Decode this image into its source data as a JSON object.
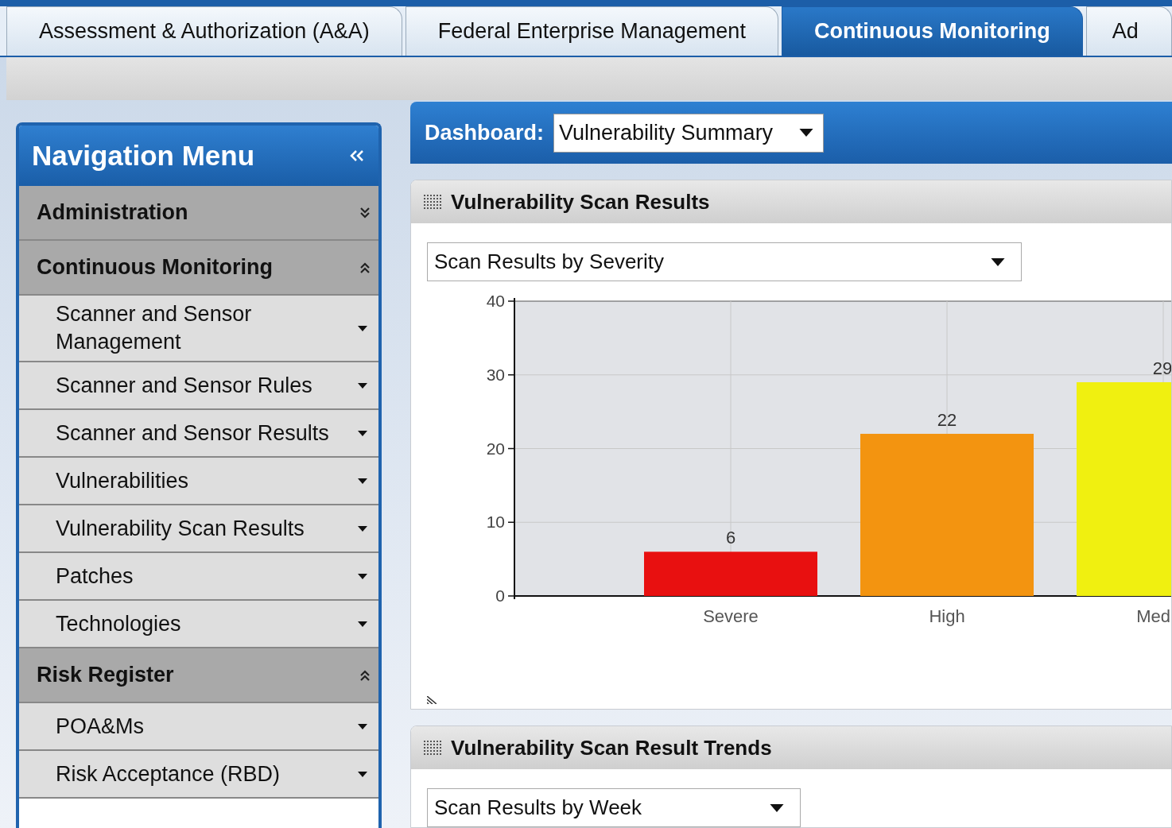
{
  "tabs": [
    {
      "label": "Assessment & Authorization (A&A)",
      "selected": false
    },
    {
      "label": "Federal Enterprise Management",
      "selected": false
    },
    {
      "label": "Continuous Monitoring",
      "selected": true
    },
    {
      "label": "Ad",
      "selected": false
    }
  ],
  "navigation": {
    "title": "Navigation Menu",
    "groups": [
      {
        "label": "Administration",
        "expanded": false
      },
      {
        "label": "Continuous Monitoring",
        "expanded": true,
        "children": [
          {
            "label": "Scanner and Sensor Management"
          },
          {
            "label": "Scanner and Sensor Rules"
          },
          {
            "label": "Scanner and Sensor Results"
          },
          {
            "label": "Vulnerabilities"
          },
          {
            "label": "Vulnerability Scan Results"
          },
          {
            "label": "Patches"
          },
          {
            "label": "Technologies"
          }
        ]
      },
      {
        "label": "Risk Register",
        "expanded": true,
        "children": [
          {
            "label": "POA&Ms"
          },
          {
            "label": "Risk Acceptance (RBD)"
          }
        ]
      }
    ]
  },
  "dashboard": {
    "label": "Dashboard:",
    "value": "Vulnerability Summary"
  },
  "panels": [
    {
      "title": "Vulnerability Scan Results",
      "select": "Scan Results by Severity",
      "chart_data": {
        "type": "bar",
        "categories": [
          "Severe",
          "High",
          "Med"
        ],
        "values": [
          6,
          22,
          29
        ],
        "ylim": [
          0,
          40
        ],
        "yticks": [
          0,
          10,
          20,
          30,
          40
        ],
        "data_labels": true,
        "grid": true,
        "colors": [
          "#e81010",
          "#f39410",
          "#f0f010"
        ]
      }
    },
    {
      "title": "Vulnerability Scan Result Trends",
      "select": "Scan Results by Week"
    }
  ]
}
